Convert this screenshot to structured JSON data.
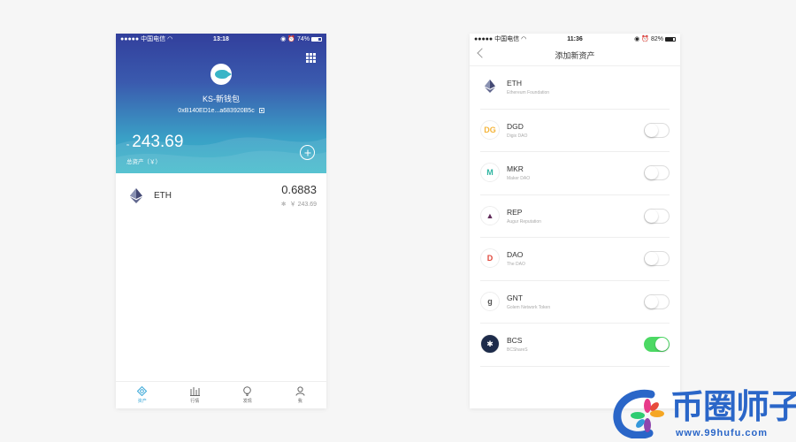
{
  "left_screen": {
    "status_bar": {
      "carrier": "中国电信",
      "signal": "●●●●●",
      "time": "13:18",
      "battery": "74%",
      "battery_fraction": 0.74
    },
    "wallet": {
      "name": "KS-新钱包",
      "address": "0xB140ED1e...a683920B5c",
      "currency_mark": "≈",
      "total_balance": "243.69",
      "total_label": "总资产（￥）"
    },
    "assets": [
      {
        "symbol": "ETH",
        "amount": "0.6883",
        "fiat_prefix": "✱",
        "fiat_value": "￥ 243.69"
      }
    ],
    "tabs": [
      {
        "label": "资产",
        "icon": "wallet-icon",
        "active": true
      },
      {
        "label": "行情",
        "icon": "chart-icon",
        "active": false
      },
      {
        "label": "发现",
        "icon": "discover-icon",
        "active": false
      },
      {
        "label": "我",
        "icon": "profile-icon",
        "active": false
      }
    ]
  },
  "right_screen": {
    "status_bar": {
      "carrier": "中国电信",
      "signal": "●●●●●",
      "time": "11:36",
      "battery": "82%",
      "battery_fraction": 0.82
    },
    "title": "添加新资产",
    "tokens": [
      {
        "symbol": "ETH",
        "name": "Ethereum Foundation",
        "icon": "eth-icon",
        "glyph": "",
        "color": "#454a75",
        "has_toggle": false,
        "enabled": true
      },
      {
        "symbol": "DGD",
        "name": "Digix DAO",
        "icon": "dgd-icon",
        "glyph": "DG",
        "color": "#f4b43a",
        "has_toggle": true,
        "enabled": false
      },
      {
        "symbol": "MKR",
        "name": "Maker DAO",
        "icon": "mkr-icon",
        "glyph": "M",
        "color": "#2fb5a1",
        "has_toggle": true,
        "enabled": false
      },
      {
        "symbol": "REP",
        "name": "Augur Reputation",
        "icon": "rep-icon",
        "glyph": "▲",
        "color": "#602b5a",
        "has_toggle": true,
        "enabled": false
      },
      {
        "symbol": "DAO",
        "name": "The DAO",
        "icon": "dao-icon",
        "glyph": "D",
        "color": "#e0463a",
        "has_toggle": true,
        "enabled": false
      },
      {
        "symbol": "GNT",
        "name": "Golem Network Token",
        "icon": "gnt-icon",
        "glyph": "g",
        "color": "#555555",
        "has_toggle": true,
        "enabled": false
      },
      {
        "symbol": "BCS",
        "name": "BCShareS",
        "icon": "bcs-icon",
        "glyph": "✱",
        "color": "#1d2b4a",
        "has_toggle": true,
        "enabled": true
      }
    ]
  },
  "watermark": {
    "brand": "币圈师子",
    "url": "www.99hufu.com"
  },
  "colors": {
    "accent": "#3aa8d8",
    "toggle_on": "#4cd964",
    "header_top": "#323f9c",
    "header_bottom": "#36b7c9"
  }
}
